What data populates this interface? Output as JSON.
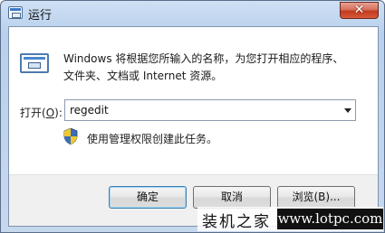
{
  "window": {
    "title": "运行",
    "close_label": "✕"
  },
  "description": {
    "line1": "Windows 将根据您所输入的名称，为您打开相应的程序、",
    "line2": "文件夹、文档或 Internet 资源。"
  },
  "open_field": {
    "label_prefix": "打开(",
    "label_key": "O",
    "label_suffix": "):",
    "value": "regedit"
  },
  "admin_note": "使用管理权限创建此任务。",
  "buttons": {
    "ok": "确定",
    "cancel": "取消",
    "browse": "浏览(B)..."
  },
  "watermark": {
    "text": "装机之家",
    "url": "www.lotpc.com"
  },
  "colors": {
    "close_button": "#c23a1f",
    "title_gradient_top": "#cfe0f4",
    "default_button_border": "#3c7fb1"
  }
}
